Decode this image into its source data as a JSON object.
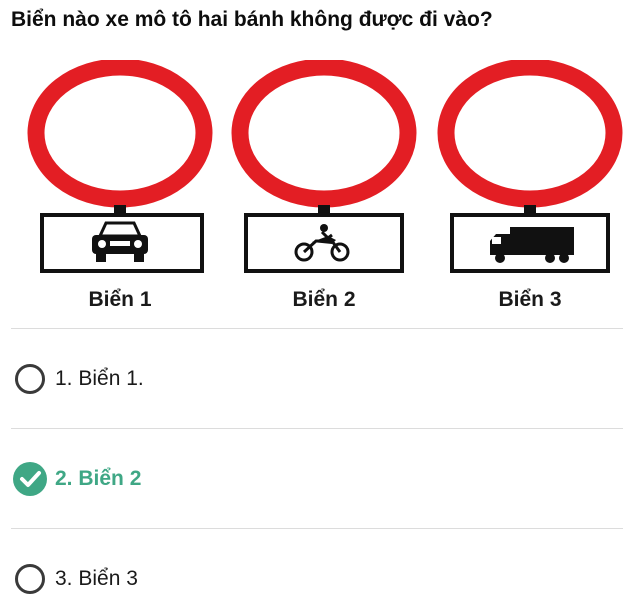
{
  "question": "Biển nào xe mô tô hai bánh không được đi vào?",
  "signs": [
    {
      "label": "Biển 1",
      "icon": "car-icon"
    },
    {
      "label": "Biển 2",
      "icon": "motorcycle-icon"
    },
    {
      "label": "Biển 3",
      "icon": "truck-icon"
    }
  ],
  "options": [
    {
      "text": "1. Biển 1.",
      "state": "unselected"
    },
    {
      "text": "2. Biển 2",
      "state": "correct"
    },
    {
      "text": "3. Biển 3",
      "state": "unselected"
    }
  ],
  "colors": {
    "sign_ring": "#e31e24",
    "correct_accent": "#3fa785",
    "divider": "#dcdcdc"
  }
}
